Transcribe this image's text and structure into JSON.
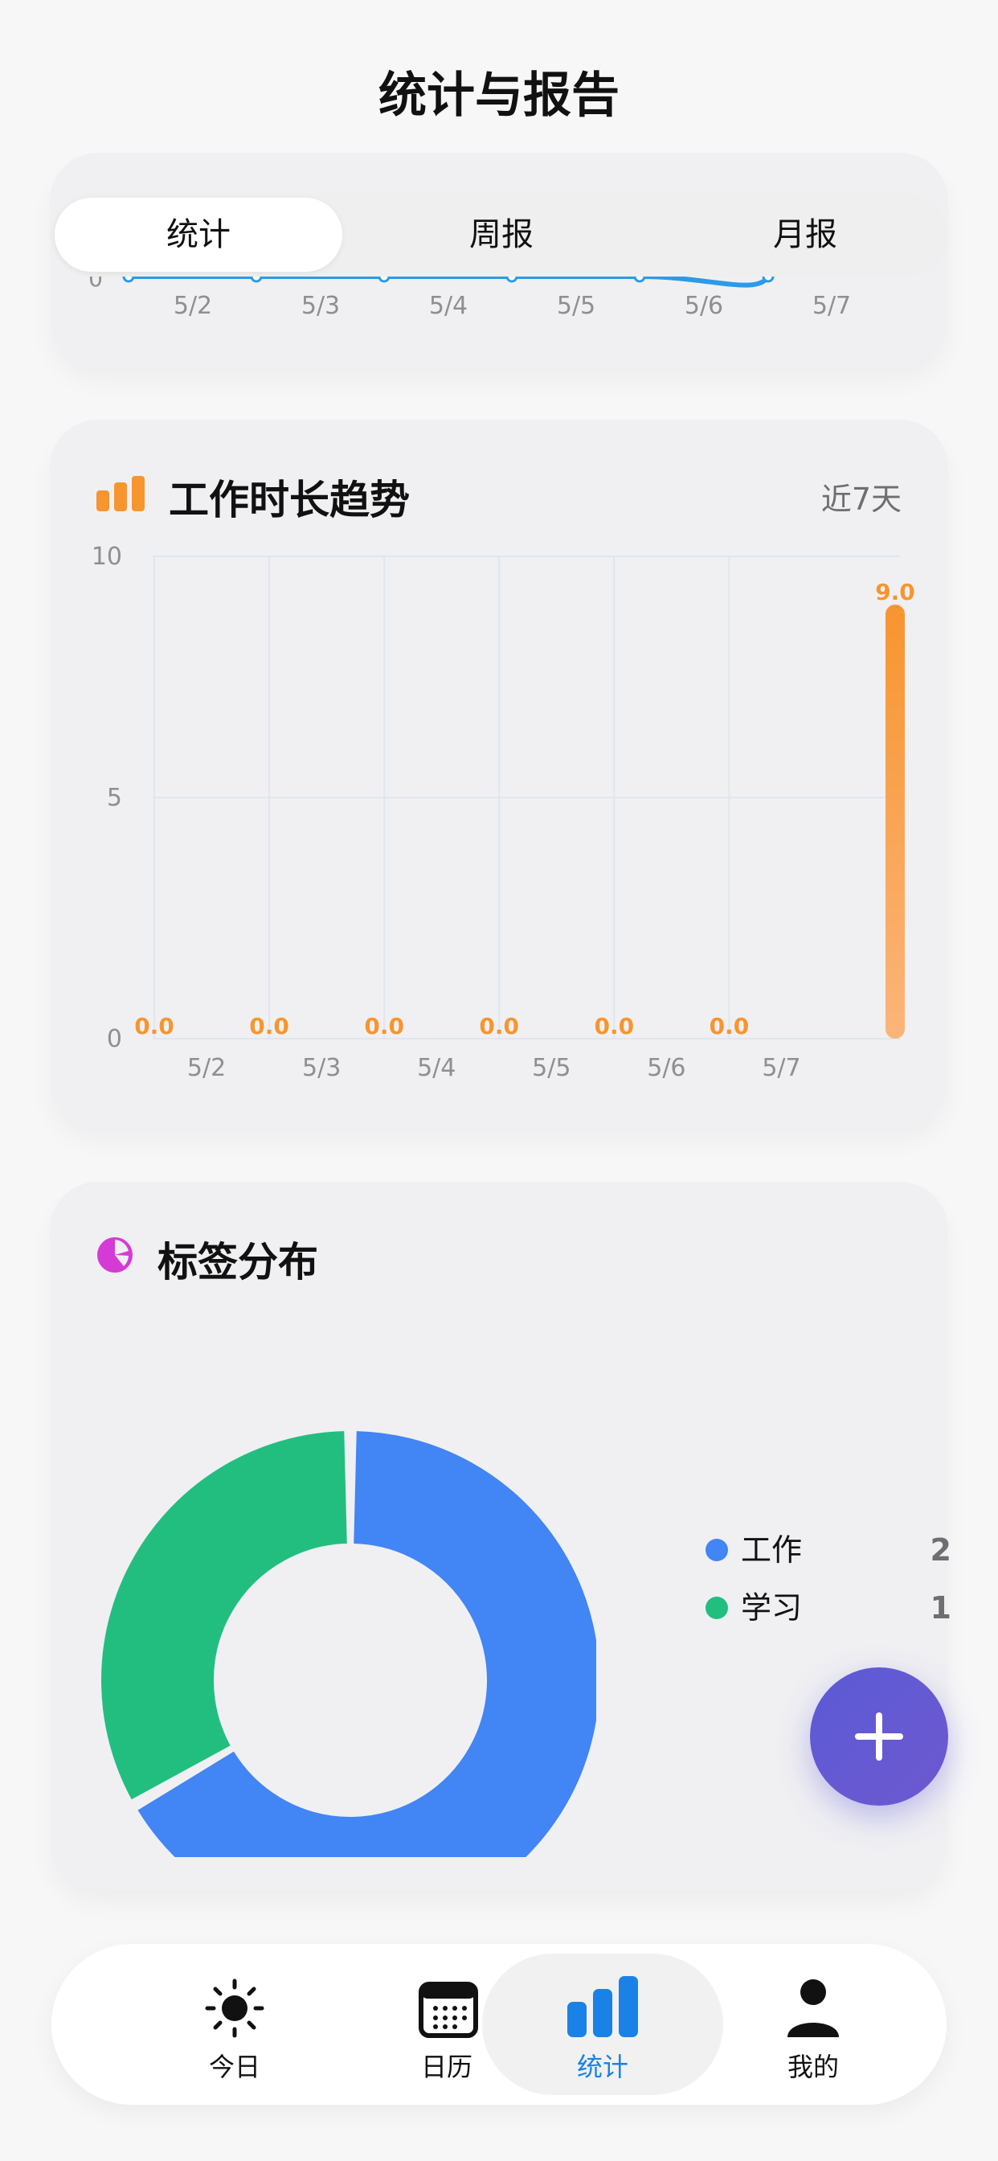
{
  "header": {
    "title": "统计与报告"
  },
  "segments": [
    {
      "label": "统计",
      "selected": true
    },
    {
      "label": "周报",
      "selected": false
    },
    {
      "label": "月报",
      "selected": false
    }
  ],
  "top_chart": {
    "y_tick": "0",
    "x_labels": [
      "5/2",
      "5/3",
      "5/4",
      "5/5",
      "5/6",
      "5/7"
    ]
  },
  "work_card": {
    "title": "工作时长趋势",
    "range": "近7天",
    "icon": "bar-chart-icon",
    "color": "#f7952f"
  },
  "chart_data": [
    {
      "type": "bar",
      "categories": [
        "",
        "5/2",
        "5/3",
        "5/4",
        "5/5",
        "5/6",
        "5/7"
      ],
      "values": [
        0.0,
        0.0,
        0.0,
        0.0,
        0.0,
        0.0,
        9.0
      ],
      "value_labels": [
        "0.0",
        "0.0",
        "0.0",
        "0.0",
        "0.0",
        "0.0",
        "9.0"
      ],
      "y_ticks": [
        "0",
        "5",
        "10"
      ],
      "ylim": [
        0,
        10
      ],
      "grid": true,
      "color": "#f7952f"
    },
    {
      "type": "pie",
      "categories": [
        "工作",
        "学习"
      ],
      "values": [
        2,
        1
      ],
      "colors": [
        "#4285f4",
        "#22be80"
      ],
      "legend": "right"
    }
  ],
  "tag_card": {
    "title": "标签分布",
    "icon": "pie-chart-icon",
    "icon_color": "#d63ad6"
  },
  "legend": [
    {
      "name": "工作",
      "value": "2",
      "color": "#4285f4"
    },
    {
      "name": "学习",
      "value": "1",
      "color": "#22be80"
    }
  ],
  "fab": {
    "icon": "plus-icon"
  },
  "tabbar": {
    "accent": "#1a82e6",
    "items": [
      {
        "label": "今日",
        "icon": "sun-icon"
      },
      {
        "label": "日历",
        "icon": "calendar-icon"
      },
      {
        "label": "统计",
        "icon": "stats-icon",
        "active": true
      },
      {
        "label": "我的",
        "icon": "person-icon"
      }
    ]
  }
}
